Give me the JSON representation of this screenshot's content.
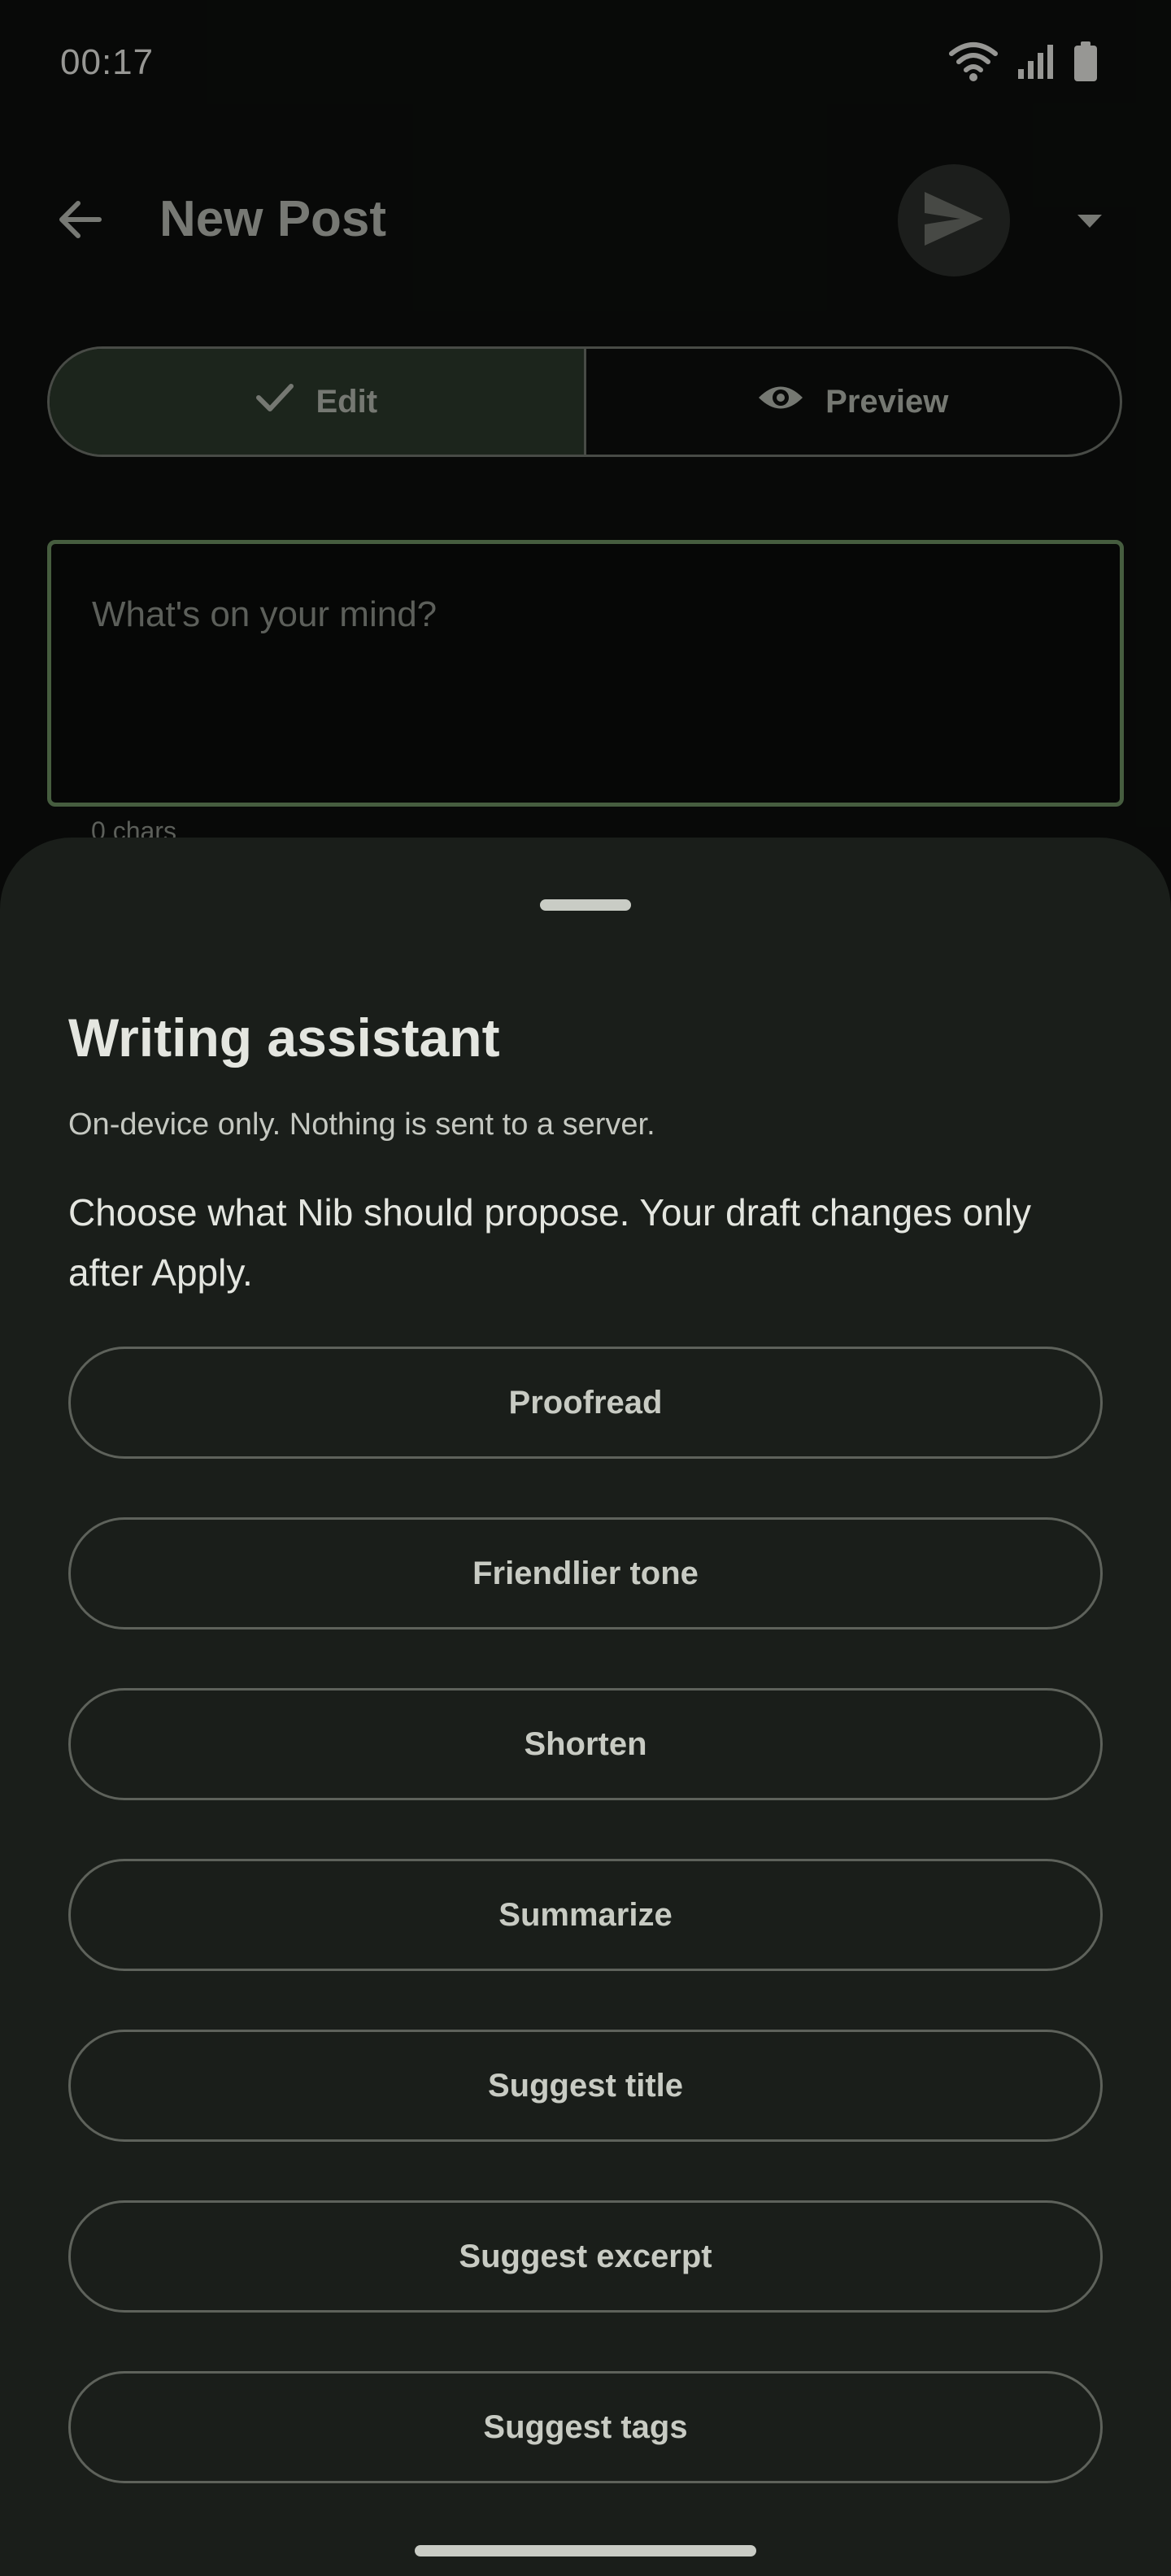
{
  "status_bar": {
    "time": "00:17",
    "icons": [
      "wifi-icon",
      "signal-icon",
      "battery-icon"
    ]
  },
  "app_bar": {
    "title": "New Post",
    "icons": [
      "back-arrow-icon",
      "send-icon",
      "caret-down-icon"
    ]
  },
  "mode_toggle": {
    "edit_label": "Edit",
    "preview_label": "Preview",
    "selected": "Edit",
    "edit_icon": "check-icon",
    "preview_icon": "eye-icon"
  },
  "editor": {
    "placeholder": "What's on your mind?",
    "value": "",
    "char_count": "0 chars"
  },
  "sheet": {
    "title": "Writing assistant",
    "note": "On-device only. Nothing is sent to a server.",
    "description": "Choose what Nib should propose. Your draft changes only after Apply.",
    "actions": [
      {
        "label": "Proofread"
      },
      {
        "label": "Friendlier tone"
      },
      {
        "label": "Shorten"
      },
      {
        "label": "Summarize"
      },
      {
        "label": "Suggest title"
      },
      {
        "label": "Suggest excerpt"
      },
      {
        "label": "Suggest tags"
      }
    ]
  },
  "colors": {
    "background": "#0d0f0d",
    "sheet": "#1a1e1a",
    "accent_green": "#6c8f62",
    "selected_segment": "#2b3a2c"
  }
}
